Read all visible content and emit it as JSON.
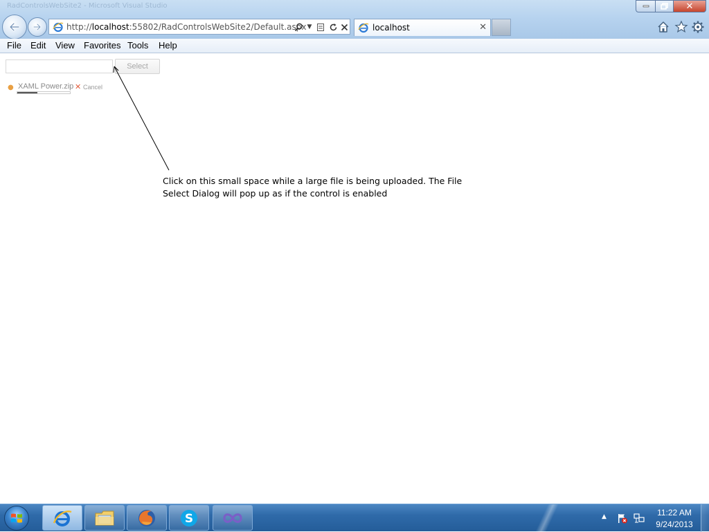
{
  "browser": {
    "title_bar_text": "RadControlsWebSite2 - Microsoft Visual Studio",
    "address": {
      "prefix": "http://",
      "host": "localhost",
      "rest": ":55802/RadControlsWebSite2/Default.aspx"
    },
    "tab_title": "localhost",
    "icons": {
      "back": "back-arrow-icon",
      "forward": "forward-arrow-icon",
      "home": "home-icon",
      "favorites": "star-icon",
      "tools": "gear-icon"
    }
  },
  "menu": {
    "items": [
      "File",
      "Edit",
      "View",
      "Favorites",
      "Tools",
      "Help"
    ]
  },
  "page": {
    "upload": {
      "select_label": "Select",
      "file_name": "XAML Power.zip",
      "progress": 0.38,
      "cancel_label": "Cancel"
    },
    "annotation": {
      "line1": "Click on this small space while a large file is being uploaded. The File",
      "line2": "Select Dialog will pop up as if the control is enabled"
    }
  },
  "taskbar": {
    "apps": [
      "Internet Explorer",
      "Windows Explorer",
      "Firefox",
      "Skype",
      "Visual Studio"
    ],
    "clock": {
      "time": "11:22 AM",
      "date": "9/24/2013"
    }
  },
  "colors": {
    "chrome_blue": "#b7d3ef",
    "taskbar_blue": "#2f6aa9",
    "close_red": "#c7452d",
    "cancel_orange": "#e25b3a"
  }
}
